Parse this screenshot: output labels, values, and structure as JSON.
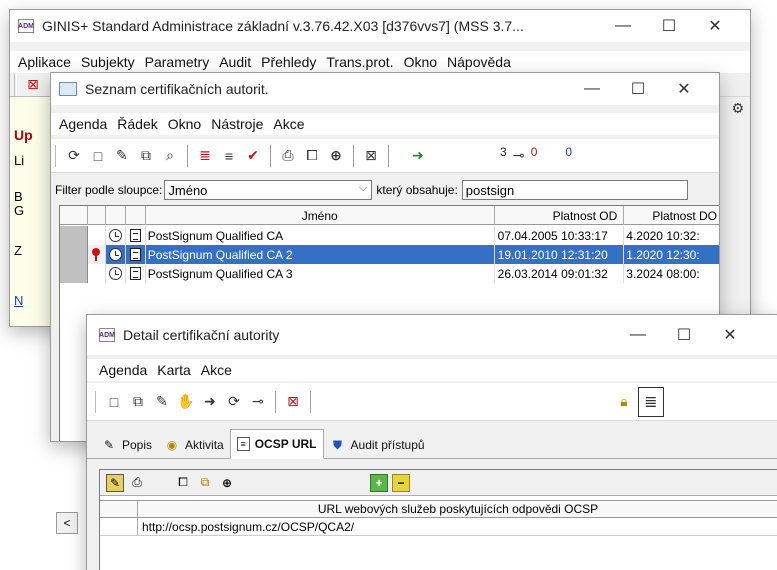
{
  "main": {
    "title": "GINIS+ Standard Administrace základní  v.3.76.42.X03 [d376vvs7] (MSS 3.7...",
    "icon_text": "ADM",
    "menu": [
      "Aplikace",
      "Subjekty",
      "Parametry",
      "Audit",
      "Přehledy",
      "Trans.prot.",
      "Okno",
      "Nápověda"
    ],
    "side_fragments": [
      "Up",
      "Li",
      "B",
      "G",
      "Z",
      "N"
    ]
  },
  "list": {
    "title": "Seznam certifikačních autorit.",
    "menu": [
      "Agenda",
      "Řádek",
      "Okno",
      "Nástroje",
      "Akce"
    ],
    "counters": [
      "3",
      "0",
      "0"
    ],
    "filter": {
      "label": "Filter podle sloupce:",
      "column": "Jméno",
      "contains_label": "který obsahuje:",
      "value": "postsign"
    },
    "columns": [
      "Jméno",
      "Platnost OD",
      "Platnost DO"
    ],
    "rows": [
      {
        "name": "PostSignum Qualified CA",
        "from": "07.04.2005 10:33:17",
        "to": "4.2020 10:32:",
        "selected": false
      },
      {
        "name": "PostSignum Qualified CA 2",
        "from": "19.01.2010 12:31:20",
        "to": "1.2020 12:30:",
        "selected": true
      },
      {
        "name": "PostSignum Qualified CA 3",
        "from": "26.03.2014 09:01:32",
        "to": "3.2024 08:00:",
        "selected": false
      }
    ]
  },
  "detail": {
    "title": "Detail certifikační autority",
    "icon_text": "ADM",
    "menu": [
      "Agenda",
      "Karta",
      "Akce"
    ],
    "tabs": [
      "Popis",
      "Aktivita",
      "OCSP URL",
      "Audit přístupů"
    ],
    "active_tab": "OCSP URL",
    "table_header": "URL webových služeb poskytujících odpovědi OCSP",
    "table_rows": [
      "http://ocsp.postsignum.cz/OCSP/QCA2/"
    ]
  },
  "colors": {
    "selection": "#3470c4",
    "side_panel": "#fdfdea",
    "error_red": "#b00000",
    "link_blue": "#1a3fb0"
  }
}
